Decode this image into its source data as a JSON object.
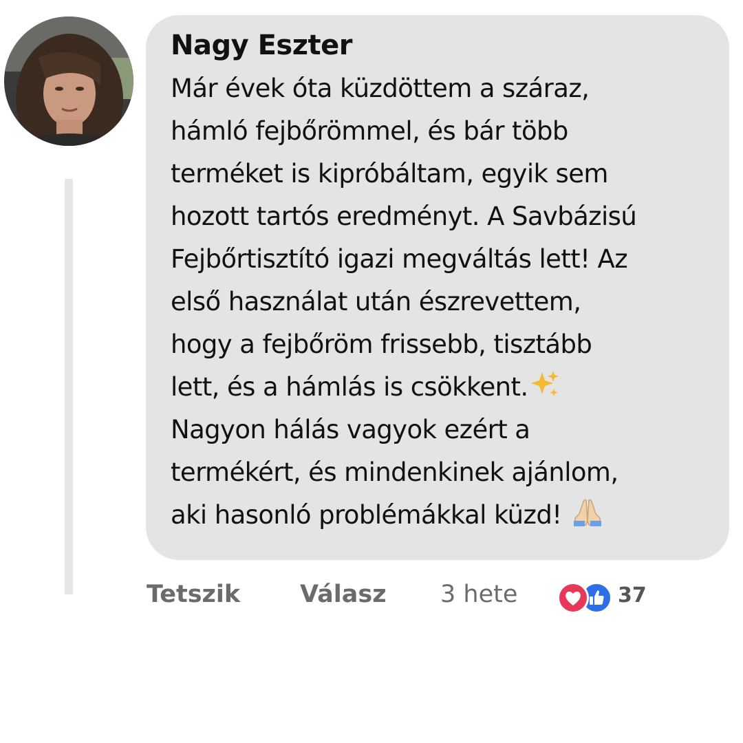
{
  "comment": {
    "author": "Nagy Eszter",
    "lines": [
      "Már évek óta küzdöttem a száraz,",
      "hámló fejbőrömmel, és bár több",
      "terméket is kipróbáltam, egyik sem",
      "hozott tartós eredményt. A Savbázisú",
      "Fejbőrtisztító igazi megváltás lett! Az",
      "első használat után észrevettem,",
      "hogy a fejbőröm frissebb, tisztább",
      "lett, és a hámlás is csökkent.",
      "Nagyon hálás vagyok ezért a",
      "termékért, és mindenkinek ajánlom,",
      "aki hasonló problémákkal küzd!"
    ],
    "emojis": {
      "line_8": "sparkles-icon",
      "line_11": "folded-hands-icon"
    }
  },
  "actions": {
    "like_label": "Tetszik",
    "reply_label": "Válasz",
    "time_label": "3 hete",
    "reaction_count": "37"
  },
  "colors": {
    "bubble": "#e4e4e4",
    "action_text": "#6b6b6b",
    "heart_reaction": "#e8385a",
    "like_reaction": "#2e6ee6",
    "sparkle": "#f5b82e"
  }
}
